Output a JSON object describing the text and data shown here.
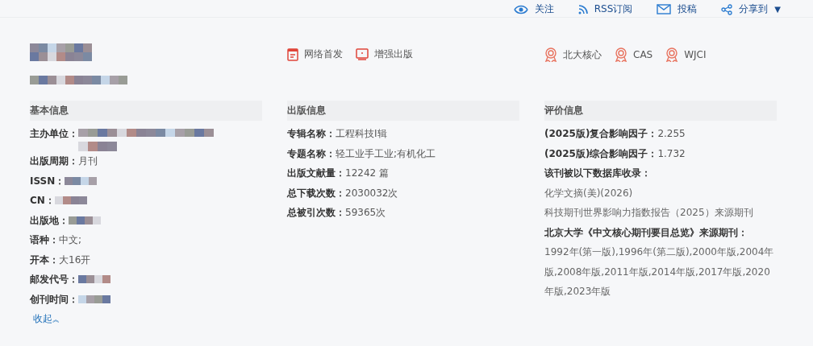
{
  "top_bar": [
    {
      "kind": "eye",
      "label": "关注"
    },
    {
      "kind": "rss",
      "label": "RSS订阅"
    },
    {
      "kind": "mail",
      "label": "投稿"
    },
    {
      "kind": "share",
      "label": "分享到",
      "caret": "▼"
    }
  ],
  "journal": {
    "title_redacted": true,
    "subtitle_redacted": true
  },
  "columns": [
    {
      "heading": "基本信息",
      "rows": [
        {
          "label": "主办单位：",
          "redacted": true,
          "kind": "long"
        },
        {
          "label": "出版周期：",
          "value": "月刊"
        },
        {
          "label": "ISSN：",
          "redacted": true,
          "kind": "short"
        },
        {
          "label": "CN：",
          "redacted": true,
          "kind": "short"
        },
        {
          "label": "出版地：",
          "redacted": true,
          "kind": "short"
        },
        {
          "label": "语种：",
          "value": "中文;"
        },
        {
          "label": "开本：",
          "value": "大16开"
        },
        {
          "label": "邮发代号：",
          "redacted": true,
          "kind": "short"
        },
        {
          "label": "创刊时间：",
          "redacted": true,
          "kind": "short"
        }
      ],
      "link": "收起",
      "link_icon": "︽"
    },
    {
      "badges": [
        {
          "kind": "doc",
          "label": "网络首发"
        },
        {
          "kind": "screen",
          "label": "增强出版"
        }
      ],
      "heading": "出版信息",
      "rows": [
        {
          "label": "专辑名称：",
          "value": "工程科技Ⅰ辑"
        },
        {
          "label": "专题名称：",
          "value": "轻工业手工业;有机化工"
        },
        {
          "label": "出版文献量：",
          "value": "12242 篇"
        },
        {
          "label": "总下载次数：",
          "value": "2030032次"
        },
        {
          "label": "总被引次数：",
          "value": "59365次"
        }
      ]
    },
    {
      "badges": [
        {
          "kind": "medal",
          "label": "北大核心"
        },
        {
          "kind": "medal",
          "label": "CAS"
        },
        {
          "kind": "medal",
          "label": "WJCI"
        }
      ],
      "heading": "评价信息",
      "rows": [
        {
          "label": "(2025版)复合影响因子：",
          "value": "2.255"
        },
        {
          "label": "(2025版)综合影响因子：",
          "value": "1.732"
        },
        {
          "label": "该刊被以下数据库收录：",
          "kind": "title"
        },
        {
          "value": "化学文摘(美)(2026)",
          "kind": "plain"
        },
        {
          "value": "科技期刊世界影响力指数报告（2025）来源期刊",
          "kind": "plain"
        },
        {
          "label": "北京大学《中文核心期刊要目总览》来源期刊：",
          "kind": "title"
        },
        {
          "value": "1992年(第一版),1996年(第二版),2000年版,2004年版,2008年版,2011年版,2014年版,2017年版,2020年版,2023年版",
          "kind": "plain"
        }
      ]
    }
  ]
}
